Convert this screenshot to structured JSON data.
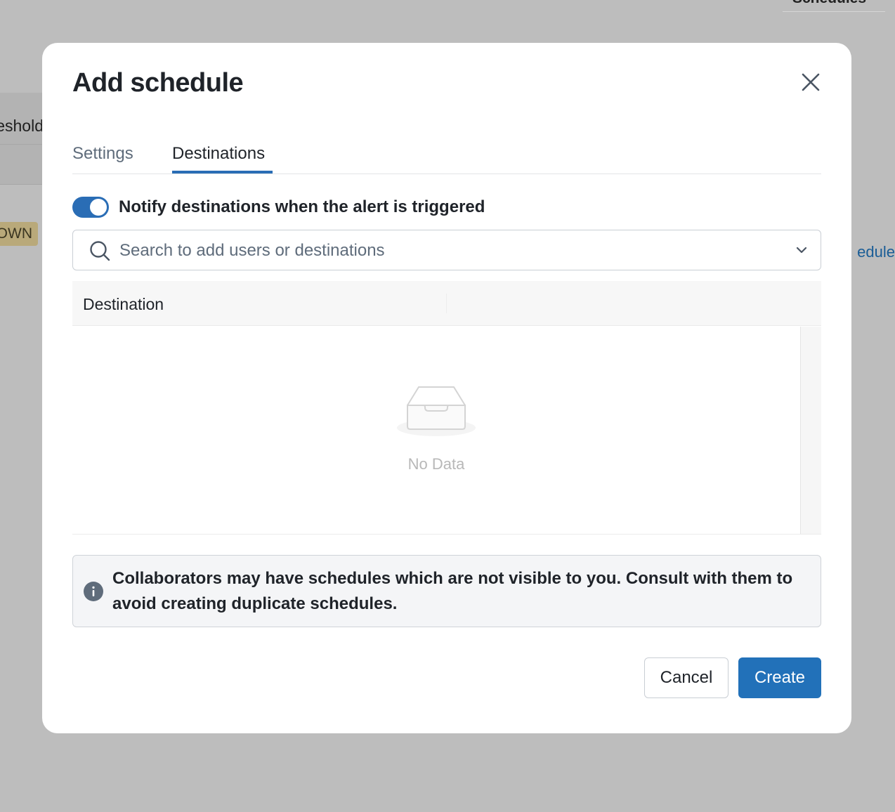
{
  "background": {
    "tab_text": "Schedules",
    "row_text": "eshold",
    "badge_text": "OWN",
    "link_text": "edule"
  },
  "modal": {
    "title": "Add schedule",
    "close_icon": "close-icon",
    "tabs": [
      {
        "label": "Settings",
        "active": false
      },
      {
        "label": "Destinations",
        "active": true
      }
    ],
    "toggle": {
      "on": true,
      "label": "Notify destinations when the alert is triggered"
    },
    "search": {
      "placeholder": "Search to add users or destinations"
    },
    "table": {
      "columns": [
        "Destination",
        ""
      ],
      "rows": [],
      "empty_text": "No Data"
    },
    "info": {
      "text": "Collaborators may have schedules which are not visible to you. Consult with them to avoid creating duplicate schedules."
    },
    "buttons": {
      "cancel": "Cancel",
      "create": "Create"
    }
  },
  "colors": {
    "accent": "#2271b9",
    "overlay": "#bdbdbd",
    "text": "#1f2329",
    "muted": "#5f6c7b"
  }
}
